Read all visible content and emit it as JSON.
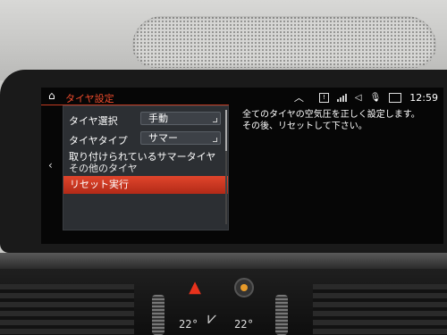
{
  "screen": {
    "title": "タイヤ設定",
    "status": {
      "time": "12:59",
      "icons": [
        "chevron-up-icon",
        "message-icon",
        "signal-icon",
        "volume-icon",
        "microphone-icon",
        "battery-icon"
      ]
    },
    "menu": {
      "tire_select_label": "タイヤ選択",
      "tire_select_value": "手動",
      "tire_type_label": "タイヤタイプ",
      "tire_type_value": "サマー",
      "installed_label": "取り付けられているサマータイヤ",
      "installed_value": "その他のタイヤ",
      "reset_label": "リセット実行"
    },
    "info": {
      "line1": "全てのタイヤの空気圧を正しく設定します。",
      "line2": "その後、リセットして下さい。"
    }
  },
  "console": {
    "temp_left": "22°",
    "temp_right": "22°"
  },
  "colors": {
    "accent": "#e0452c",
    "panel": "#2c2f33",
    "screen_bg": "#060606"
  }
}
